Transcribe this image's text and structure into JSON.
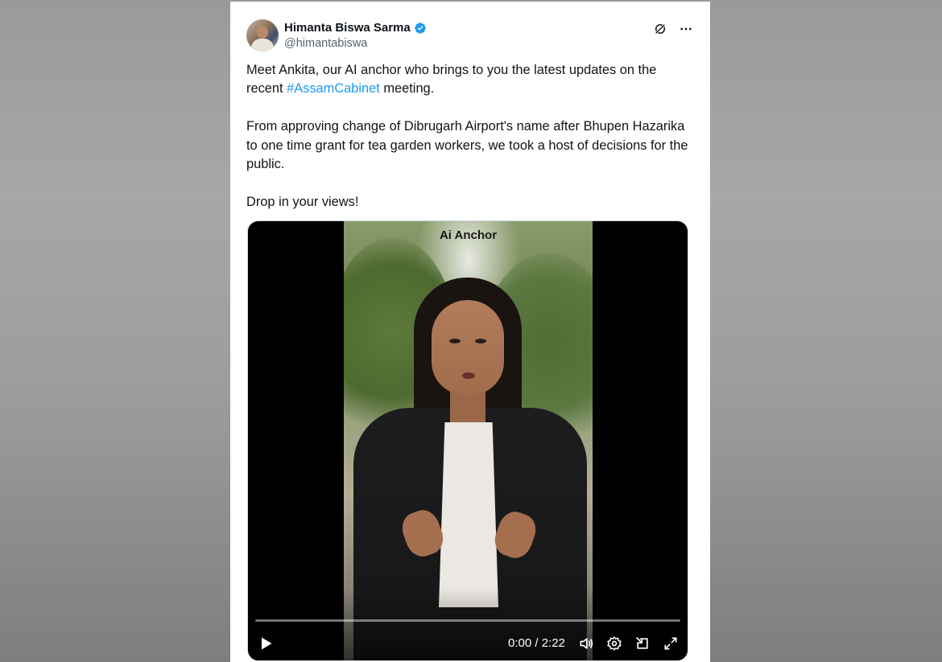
{
  "tweet": {
    "author": {
      "display_name": "Himanta Biswa Sarma",
      "handle": "@himantabiswa",
      "verified": true
    },
    "paragraphs": [
      {
        "before": "Meet Ankita, our AI anchor who brings to you the latest updates on the recent ",
        "hashtag": "#AssamCabinet",
        "after": " meeting."
      },
      {
        "text": "From approving change of Dibrugarh Airport's name after Bhupen Hazarika to one time grant for tea garden workers, we took a host of decisions for the public."
      },
      {
        "text": "Drop in your views!"
      }
    ]
  },
  "video": {
    "overlay_title": "Ai Anchor",
    "time_display": "0:00 / 2:22",
    "progress": 0
  },
  "icons": {
    "grok": "grok-icon",
    "more": "more-icon",
    "play": "play-icon",
    "volume": "volume-icon",
    "settings": "settings-icon",
    "pip": "picture-in-picture-icon",
    "fullscreen": "fullscreen-icon"
  },
  "colors": {
    "link": "#1d9bf0",
    "verified": "#1d9bf0",
    "text": "#0f1419",
    "secondary": "#536471"
  }
}
